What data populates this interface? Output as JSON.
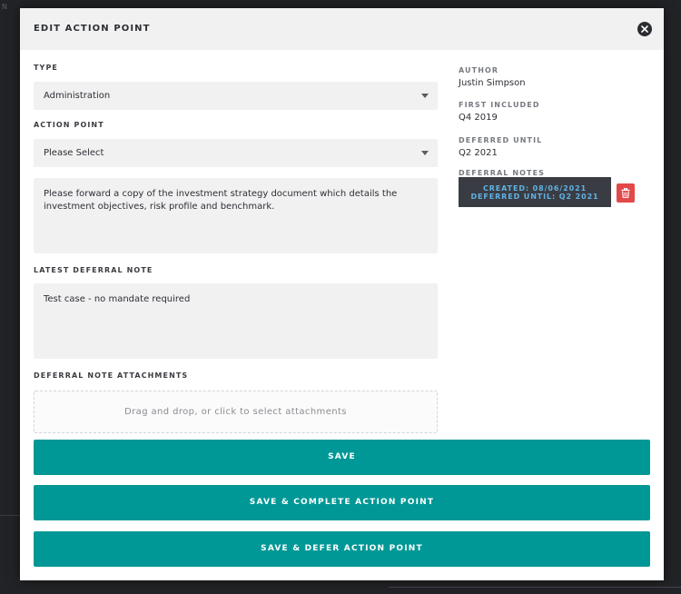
{
  "background": {
    "corner_text": "N"
  },
  "modal": {
    "title": "EDIT ACTION POINT",
    "close_icon": "close-circle-icon"
  },
  "form": {
    "type": {
      "label": "TYPE",
      "value": "Administration"
    },
    "action_point": {
      "label": "ACTION POINT",
      "value": "Please Select"
    },
    "description": "Please forward a copy of the investment strategy document which details the investment objectives, risk profile and benchmark.",
    "latest_deferral_note": {
      "label": "LATEST DEFERRAL NOTE",
      "value": "Test case - no mandate required"
    },
    "attachments": {
      "label": "DEFERRAL NOTE ATTACHMENTS",
      "placeholder": "Drag and drop, or click to select attachments"
    }
  },
  "sidebar": {
    "author": {
      "label": "AUTHOR",
      "value": "Justin Simpson"
    },
    "first_included": {
      "label": "FIRST INCLUDED",
      "value": "Q4 2019"
    },
    "deferred_until": {
      "label": "DEFERRED UNTIL",
      "value": "Q2 2021"
    },
    "deferral_notes": {
      "label": "DEFERRAL NOTES",
      "items": [
        {
          "created": "CREATED: 08/06/2021",
          "deferred_until": "DEFERRED UNTIL: Q2 2021"
        }
      ]
    }
  },
  "buttons": {
    "save": "SAVE",
    "save_complete": "SAVE & COMPLETE ACTION POINT",
    "save_defer": "SAVE & DEFER ACTION POINT"
  },
  "colors": {
    "accent": "#009896",
    "danger": "#e34848",
    "note_chip_bg": "#3a3c44",
    "note_chip_text": "#5fb3e4"
  }
}
